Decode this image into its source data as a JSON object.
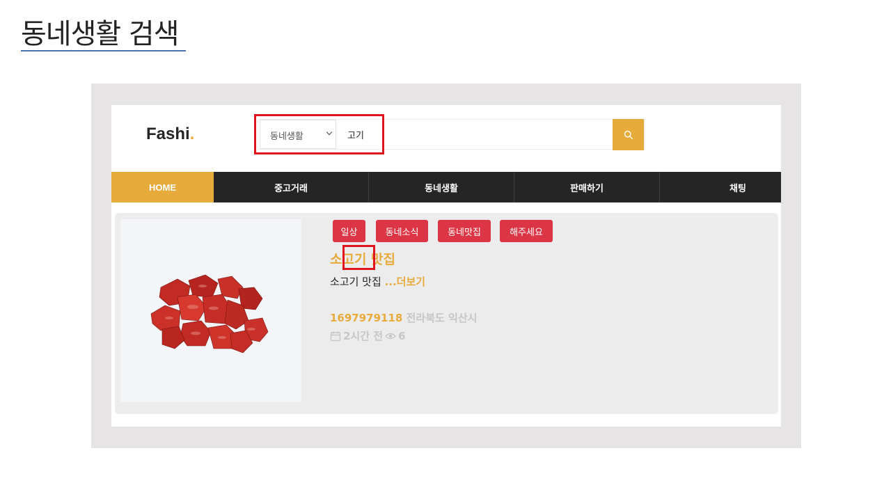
{
  "slide": {
    "title": "동네생활 검색"
  },
  "header": {
    "logo": {
      "text": "Fashi",
      "dot": "."
    },
    "search": {
      "category": "동네생활",
      "query": "고기"
    }
  },
  "nav": {
    "items": [
      {
        "label": "HOME"
      },
      {
        "label": "중고거래"
      },
      {
        "label": "동네생활"
      },
      {
        "label": "판매하기"
      },
      {
        "label": "채팅"
      }
    ]
  },
  "post": {
    "image_name": "beef-cubes-image",
    "tags": [
      "일상",
      "동네소식",
      "동네맛집",
      "해주세요"
    ],
    "title": "소고기 맛집",
    "description": "소고기 맛집",
    "more": "...더보기",
    "id_number": "1697979118",
    "location": "전라북도 익산시",
    "time": "2시간 전",
    "views": "6"
  },
  "colors": {
    "accent": "#e7ab3c",
    "tag": "#dc3545",
    "nav": "#252525",
    "highlight": "#e0141a"
  }
}
